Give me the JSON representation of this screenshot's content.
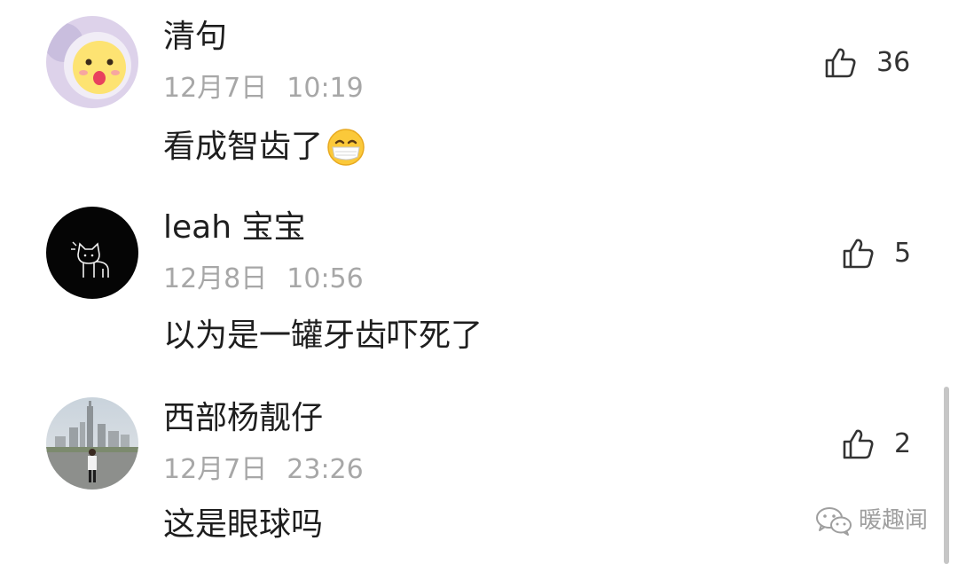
{
  "comments": [
    {
      "username": "清句",
      "date": "12月7日",
      "time": "10:19",
      "text": "看成智齿了",
      "likes": "36",
      "avatar_icon": "cartoon-face-avatar",
      "content_emoji": "smiling-face-with-mask-emoji"
    },
    {
      "username": "leah 宝宝",
      "date": "12月8日",
      "time": "10:56",
      "text": "以为是一罐牙齿吓死了",
      "likes": "5",
      "avatar_icon": "sketch-cat-avatar"
    },
    {
      "username": "西部杨靓仔",
      "date": "12月7日",
      "time": "23:26",
      "text": "这是眼球吗",
      "likes": "2",
      "avatar_icon": "city-photo-avatar"
    }
  ],
  "watermark": {
    "text": "暖趣闻",
    "icon": "wechat-icon"
  },
  "colors": {
    "text": "#1e1e1e",
    "meta": "#a7a7a7",
    "like": "#333333",
    "background": "#ffffff"
  }
}
